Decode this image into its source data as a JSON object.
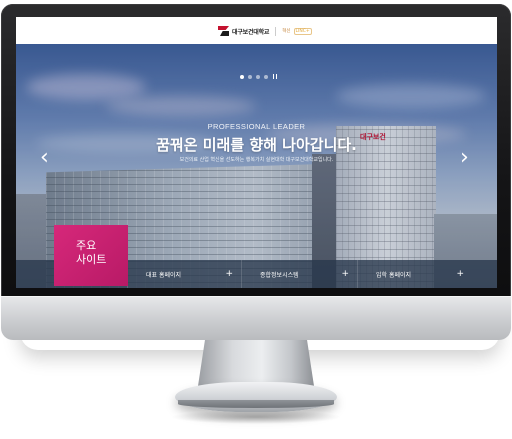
{
  "header": {
    "logo_text": "대구보건대학교",
    "logo_sub": "혁신",
    "logo_sub2": "LINC+"
  },
  "hero": {
    "kicker": "PROFESSIONAL LEADER",
    "title": "꿈꿔온 미래를 향해 나아갑니다.",
    "subtitle": "보건의료 산업 혁신을 선도하는 행복가치 실현대학 대구보건대학교입니다.",
    "building_sign": "대구보건",
    "slider": {
      "count": 4,
      "active_index": 0
    }
  },
  "quickbar": {
    "main_label_line1": "주요",
    "main_label_line2": "사이트",
    "items": [
      {
        "label": "대표 홈페이지"
      },
      {
        "label": "종합정보시스템"
      },
      {
        "label": "입학 홈페이지"
      }
    ]
  },
  "colors": {
    "accent_pink": "#d6287a",
    "brand_red": "#c4122f"
  },
  "icons": {
    "prev": "chevron-left-icon",
    "next": "chevron-right-icon",
    "plus": "plus-icon",
    "pause": "pause-icon"
  }
}
